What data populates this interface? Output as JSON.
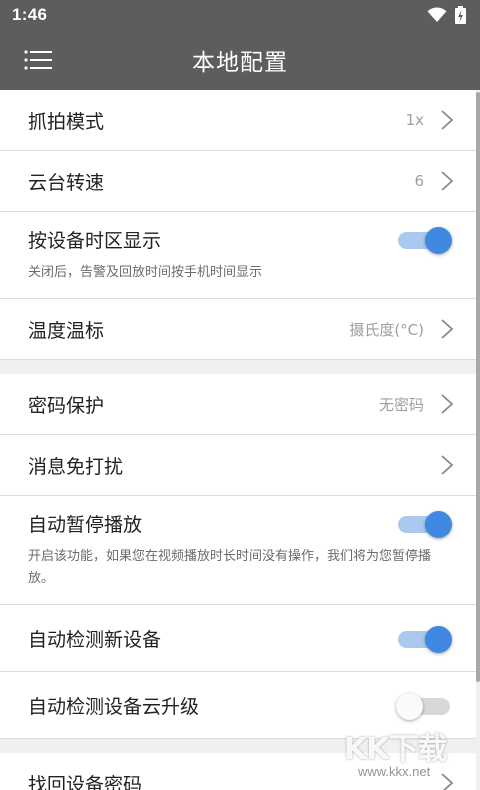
{
  "status_bar": {
    "time": "1:46"
  },
  "app_bar": {
    "title": "本地配置",
    "menu_icon": "hamburger-menu-icon"
  },
  "settings": {
    "capture_mode": {
      "label": "抓拍模式",
      "value": "1x"
    },
    "ptz_speed": {
      "label": "云台转速",
      "value": "6"
    },
    "device_timezone": {
      "label": "按设备时区显示",
      "desc": "关闭后，告警及回放时间按手机时间显示",
      "enabled": true
    },
    "temperature_unit": {
      "label": "温度温标",
      "value": "摄氏度(°C)"
    },
    "password_protect": {
      "label": "密码保护",
      "value": "无密码"
    },
    "do_not_disturb": {
      "label": "消息免打扰"
    },
    "auto_pause": {
      "label": "自动暂停播放",
      "desc": "开启该功能，如果您在视频播放时长时间没有操作，我们将为您暂停播放。",
      "enabled": true
    },
    "auto_detect_device": {
      "label": "自动检测新设备",
      "enabled": true
    },
    "auto_cloud_upgrade": {
      "label": "自动检测设备云升级",
      "enabled": false
    },
    "recover_password": {
      "label": "找回设备密码"
    }
  },
  "watermark": {
    "text": "KK下载",
    "url": "www.kkx.net"
  },
  "colors": {
    "app_bar": "#5d5d5d",
    "accent": "#3f8ae0",
    "toggle_track_on": "#a9c9ef"
  }
}
